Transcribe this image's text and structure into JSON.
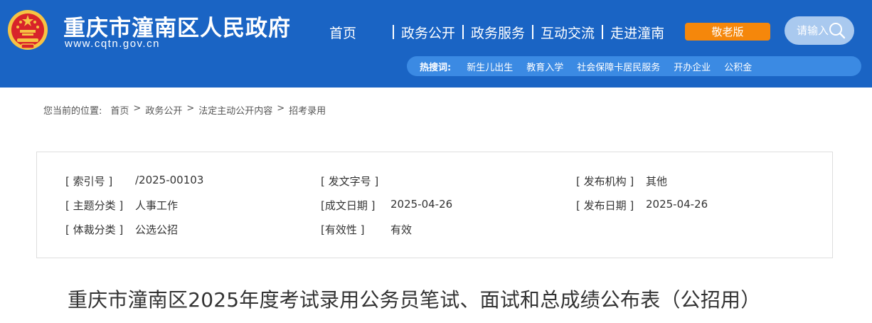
{
  "header": {
    "site_title": "重庆市潼南区人民政府",
    "site_url": "www.cqtn.gov.cn",
    "nav": [
      "首页",
      "政务公开",
      "政务服务",
      "互动交流",
      "走进潼南"
    ],
    "elder_button": "敬老版",
    "search_placeholder": "请输入",
    "hot_label": "热搜词:",
    "hot_words": [
      "新生儿出生",
      "教育入学",
      "社会保障卡居民服务",
      "开办企业",
      "公积金"
    ],
    "colors": {
      "header_bg": "#1a64c4",
      "elder_button": "#f5870b",
      "hot_bar": "#3b8ae3"
    }
  },
  "breadcrumb": {
    "prefix": "您当前的位置:",
    "items": [
      "首页",
      "政务公开",
      "法定主动公开内容",
      "招考录用"
    ],
    "separator": ">"
  },
  "info": {
    "index_label": "[ 索引号 ]",
    "index_value": "/2025-00103",
    "doc_no_label": "[ 发文字号 ]",
    "doc_no_value": "",
    "agency_label": "[ 发布机构 ]",
    "agency_value": "其他",
    "topic_label": "[ 主题分类 ]",
    "topic_value": "人事工作",
    "written_label": "[成文日期 ]",
    "written_value": "2025-04-26",
    "publish_label": "[ 发布日期 ]",
    "publish_value": "2025-04-26",
    "genre_label": "[ 体裁分类 ]",
    "genre_value": "公选公招",
    "validity_label": "[有效性 ]",
    "validity_value": "有效"
  },
  "article": {
    "title": "重庆市潼南区2025年度考试录用公务员笔试、面试和总成绩公布表（公招用）"
  }
}
